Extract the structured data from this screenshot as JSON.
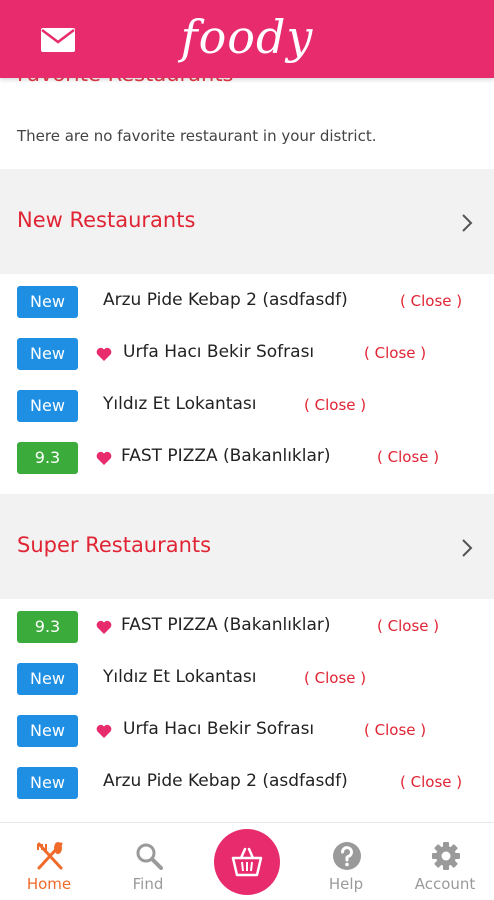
{
  "header": {
    "logo_text": "foody",
    "mail_icon": "mail-icon",
    "color": "#e72b6d"
  },
  "favorites": {
    "title": "Favorite Restaurants",
    "empty_message": "There are no favorite restaurant in your district."
  },
  "new_restaurants": {
    "title": "New Restaurants",
    "rows": [
      {
        "badge": "New",
        "name": "Arzu Pide Kebap 2 (asdfasdf)",
        "status": "( Close )",
        "favorite": false
      },
      {
        "badge": "New",
        "name": "Urfa Hacı Bekir Sofrası",
        "status": "( Close )",
        "favorite": true
      },
      {
        "badge": "New",
        "name": "Yıldız Et Lokantası",
        "status": "( Close )",
        "favorite": false
      },
      {
        "badge": "9.3",
        "name": "FAST PIZZA (Bakanlıklar)",
        "status": "( Close )",
        "favorite": true
      }
    ]
  },
  "super_restaurants": {
    "title": "Super Restaurants",
    "rows": [
      {
        "badge": "9.3",
        "name": "FAST PIZZA (Bakanlıklar)",
        "status": "( Close )",
        "favorite": true
      },
      {
        "badge": "New",
        "name": "Yıldız Et Lokantası",
        "status": "( Close )",
        "favorite": false
      },
      {
        "badge": "New",
        "name": "Urfa Hacı Bekir Sofrası",
        "status": "( Close )",
        "favorite": true
      },
      {
        "badge": "New",
        "name": "Arzu Pide Kebap 2 (asdfasdf)",
        "status": "( Close )",
        "favorite": false
      }
    ]
  },
  "tabbar": {
    "home": "Home",
    "find": "Find",
    "help": "Help",
    "account": "Account",
    "active": "Home"
  },
  "colors": {
    "brand": "#e72b6d",
    "section_title": "#e02434",
    "badge_new": "#1f8fe4",
    "badge_score": "#3bab3b",
    "active_tab": "#f06a2a"
  }
}
